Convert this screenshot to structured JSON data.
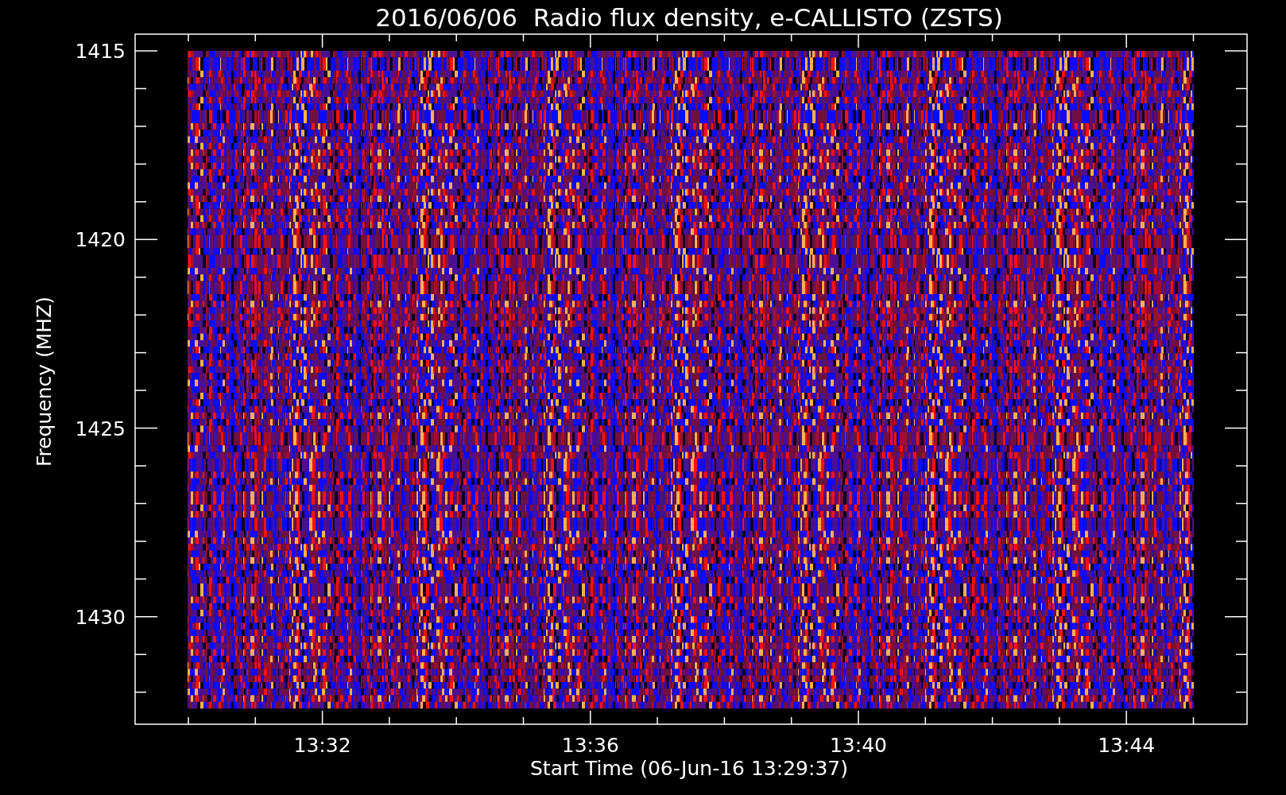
{
  "title": "2016/06/06  Radio flux density, e-CALLISTO (ZSTS)",
  "y_axis": {
    "label": "Frequency (MHZ)",
    "ticks": [
      "1415",
      "1420",
      "1425",
      "1430"
    ]
  },
  "x_axis": {
    "label": "Start Time (06-Jun-16 13:29:37)",
    "ticks": [
      "13:32",
      "13:36",
      "13:40",
      "13:44"
    ]
  }
}
